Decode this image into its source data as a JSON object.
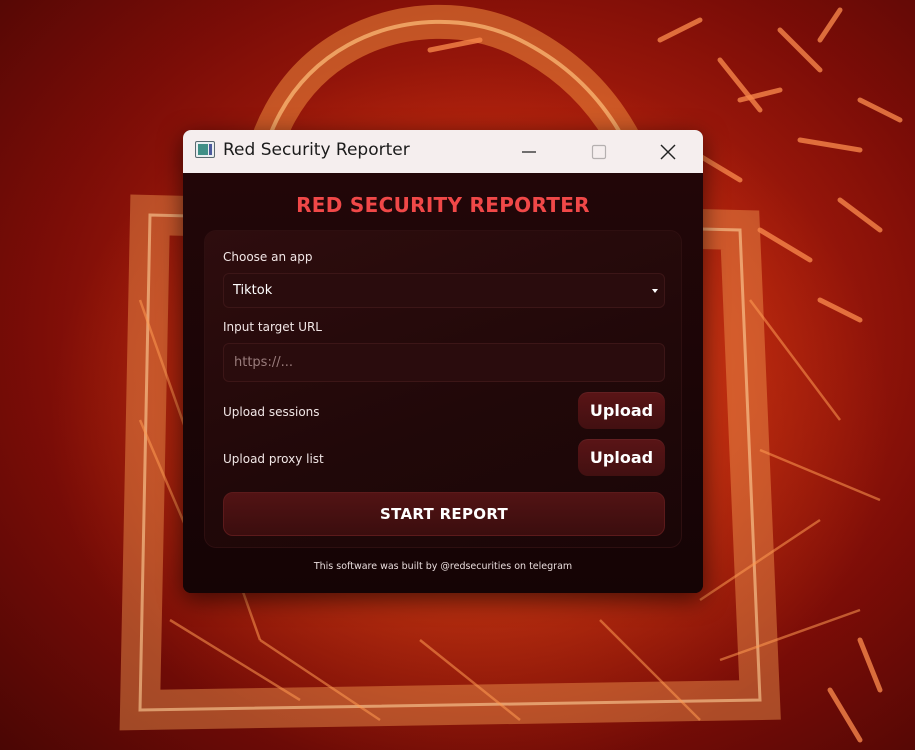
{
  "window": {
    "title": "Red Security Reporter"
  },
  "app": {
    "heading": "RED SECURITY REPORTER",
    "choose_app_label": "Choose an app",
    "selected_app": "Tiktok",
    "url_label": "Input target URL",
    "url_value": "",
    "url_placeholder": "https://...",
    "sessions_label": "Upload sessions",
    "sessions_button": "Upload",
    "proxy_label": "Upload proxy list",
    "proxy_button": "Upload",
    "start_button": "START REPORT",
    "footer": "This software was built by @redsecurities on telegram"
  },
  "icons": {
    "app": "app-window-icon",
    "minimize": "minimize-icon",
    "maximize": "maximize-icon",
    "close": "close-icon",
    "dropdown": "chevron-down-icon"
  },
  "colors": {
    "heading": "#f04848",
    "window_bg": "#170506",
    "button_bg": "#4a1112",
    "titlebar_bg": "#f5eeee"
  }
}
